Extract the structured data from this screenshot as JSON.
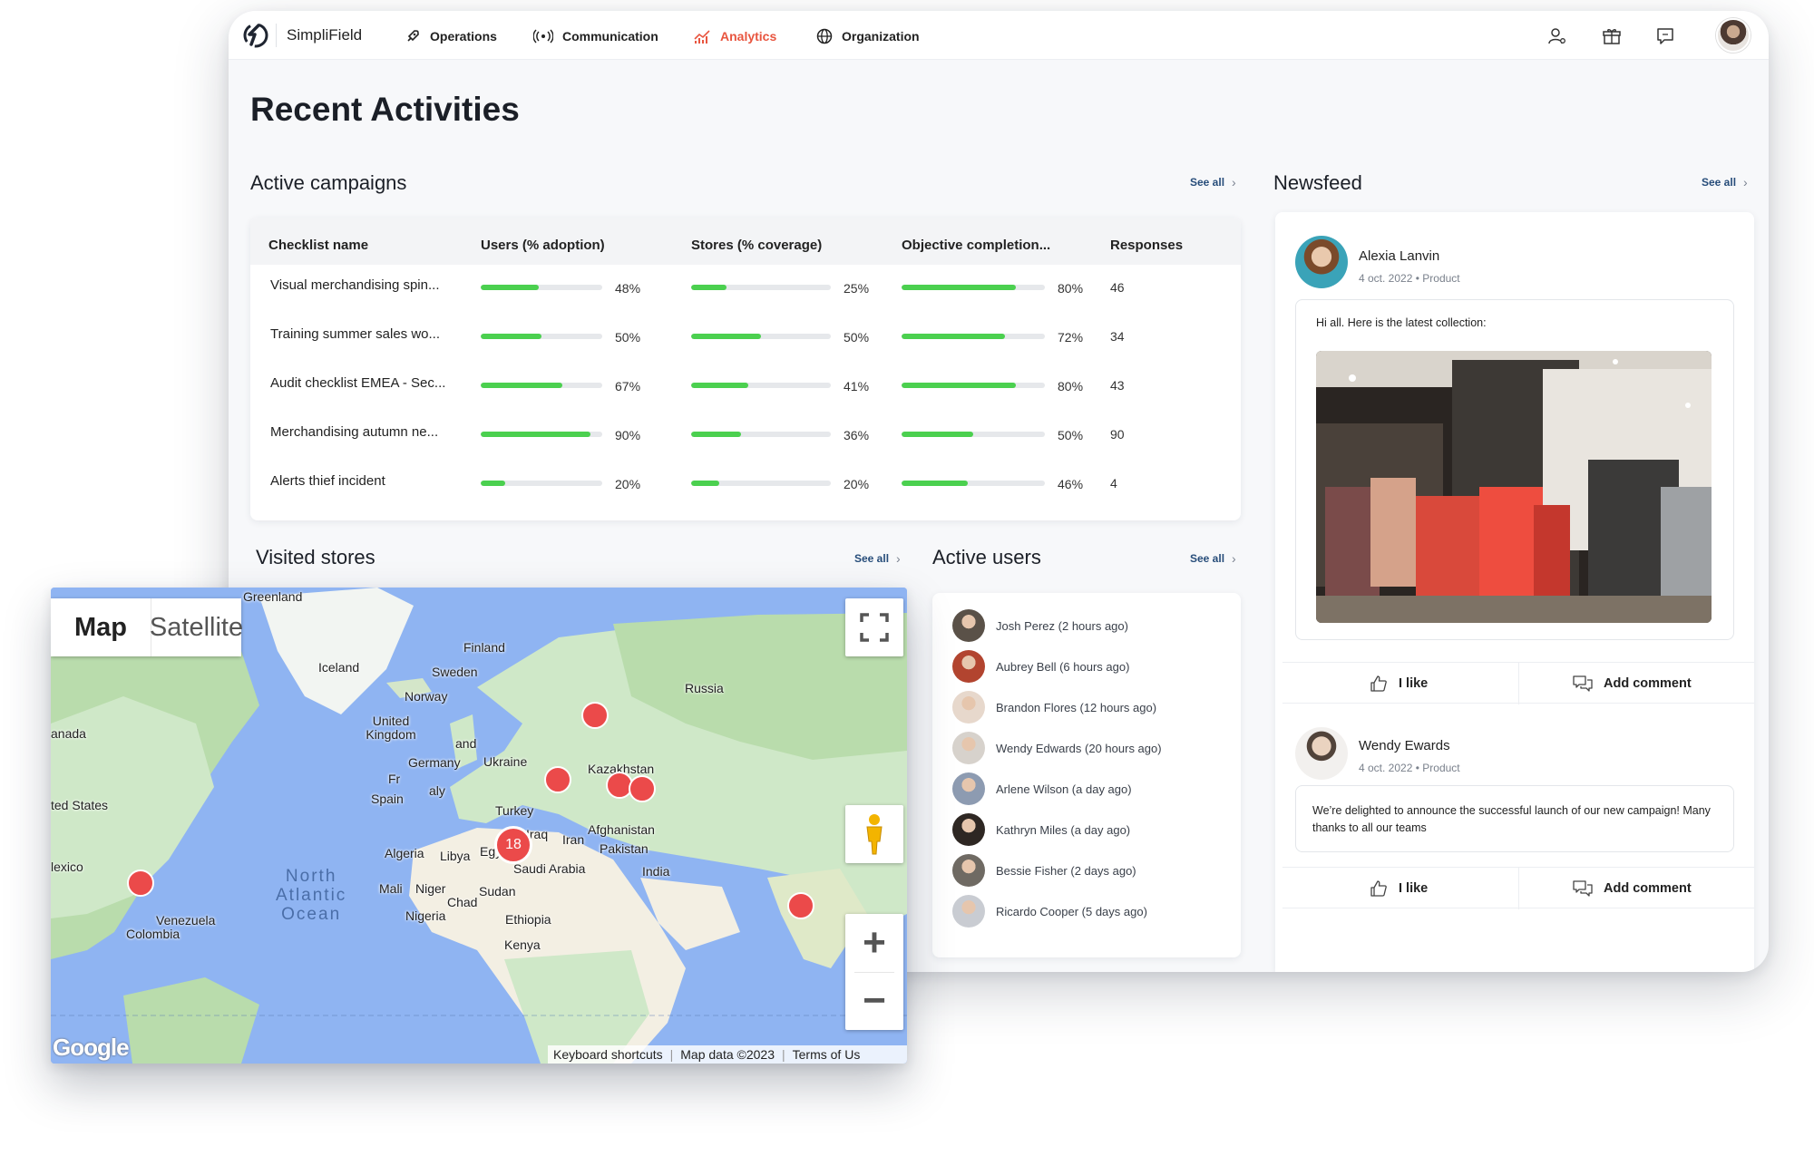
{
  "app": {
    "brand": "SimpliField"
  },
  "nav": [
    {
      "label": "Operations",
      "icon": "rocket-icon"
    },
    {
      "label": "Communication",
      "icon": "broadcast-icon"
    },
    {
      "label": "Analytics",
      "icon": "analytics-icon",
      "active": true
    },
    {
      "label": "Organization",
      "icon": "globe-icon"
    }
  ],
  "top_icons": [
    "user-settings-icon",
    "gift-icon",
    "chat-icon"
  ],
  "page_title": "Recent Activities",
  "see_all": "See all",
  "campaigns": {
    "title": "Active campaigns",
    "headers": [
      "Checklist name",
      "Users (% adoption)",
      "Stores (% coverage)",
      "Objective completion...",
      "Responses"
    ],
    "rows": [
      {
        "name": "Visual merchandising spin...",
        "users": "48%",
        "users_v": 48,
        "stores": "25%",
        "stores_v": 25,
        "objective": "80%",
        "objective_v": 80,
        "responses": "46"
      },
      {
        "name": "Training summer sales wo...",
        "users": "50%",
        "users_v": 50,
        "stores": "50%",
        "stores_v": 50,
        "objective": "72%",
        "objective_v": 72,
        "responses": "34"
      },
      {
        "name": "Audit checklist EMEA - Sec...",
        "users": "67%",
        "users_v": 67,
        "stores": "41%",
        "stores_v": 41,
        "objective": "80%",
        "objective_v": 80,
        "responses": "43"
      },
      {
        "name": "Merchandising autumn ne...",
        "users": "90%",
        "users_v": 90,
        "stores": "36%",
        "stores_v": 36,
        "objective": "50%",
        "objective_v": 50,
        "responses": "90"
      },
      {
        "name": "Alerts thief incident",
        "users": "20%",
        "users_v": 20,
        "stores": "20%",
        "stores_v": 20,
        "objective": "46%",
        "objective_v": 46,
        "responses": "4"
      }
    ]
  },
  "visited_stores": {
    "title": "Visited stores"
  },
  "active_users": {
    "title": "Active users",
    "users": [
      {
        "label": "Josh Perez (2 hours ago)",
        "color": "#5a5148"
      },
      {
        "label": "Aubrey Bell (6 hours ago)",
        "color": "#b2442f"
      },
      {
        "label": "Brandon Flores (12 hours ago)",
        "color": "#e7d8cc"
      },
      {
        "label": "Wendy Edwards (20 hours ago)",
        "color": "#d7d2cc"
      },
      {
        "label": "Arlene Wilson (a day ago)",
        "color": "#8d9bb1"
      },
      {
        "label": "Kathryn Miles (a day ago)",
        "color": "#2e2723"
      },
      {
        "label": "Bessie Fisher (2 days ago)",
        "color": "#6f6a63"
      },
      {
        "label": "Ricardo Cooper (5 days ago)",
        "color": "#c9ccd2"
      }
    ]
  },
  "newsfeed": {
    "title": "Newsfeed",
    "posts": [
      {
        "author": "Alexia Lanvin",
        "date": "4 oct. 2022",
        "category": "Product",
        "text": "Hi all. Here is the latest collection:",
        "like": "I like",
        "comment": "Add comment"
      },
      {
        "author": "Wendy Ewards",
        "date": "4 oct. 2022",
        "category": "Product",
        "text": "We’re delighted to announce the successful launch of our new campaign! Many thanks to all our teams",
        "like": "I like",
        "comment": "Add comment"
      }
    ],
    "image_alt": "Clothing store interior"
  },
  "map": {
    "tabs": [
      "Map",
      "Satellite"
    ],
    "labels": [
      "Greenland",
      "Iceland",
      "Finland",
      "Sweden",
      "Norway",
      "Russia",
      "United Kingdom",
      "Germany",
      "Ukraine",
      "Kazakhstan",
      "Spain",
      "Turkey",
      "Iraq",
      "Iran",
      "Afghanistan",
      "Pakistan",
      "India",
      "Algeria",
      "Libya",
      "Egypt",
      "Saudi Arabia",
      "Mali",
      "Niger",
      "Sudan",
      "Chad",
      "Nigeria",
      "Ethiopia",
      "Kenya",
      "Venezuela",
      "Colombia",
      "anada",
      "ted States",
      "lexico",
      "Fr",
      "aly",
      "and"
    ],
    "ocean": [
      "North",
      "Atlantic",
      "Ocean"
    ],
    "cluster_count": "18",
    "footer": [
      "Keyboard shortcuts",
      "Map data ©2023",
      "Terms of Us"
    ],
    "google": "Google",
    "zoom_in": "+",
    "zoom_out": "−"
  },
  "colors": {
    "accent": "#e8553f",
    "progress": "#4bd04f",
    "link": "#274d7a",
    "marker": "#eb4a4a",
    "water": "#8fb4f2",
    "land": "#cfe8c8"
  }
}
